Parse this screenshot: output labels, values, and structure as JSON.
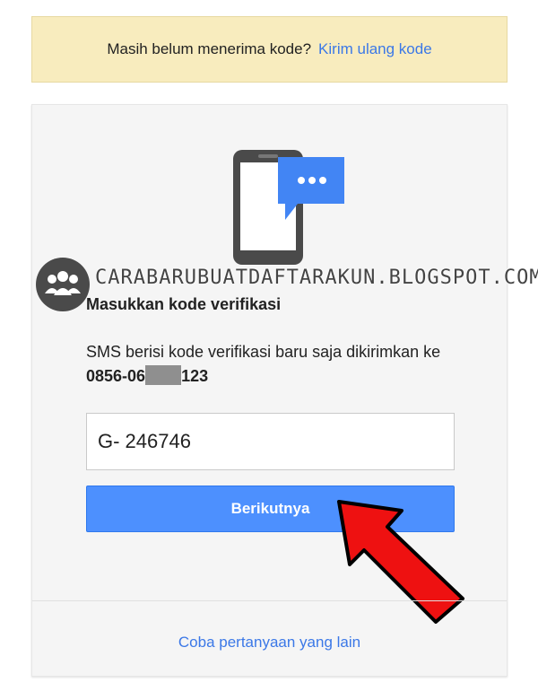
{
  "banner": {
    "message": "Masih belum menerima kode?",
    "resend_link": "Kirim ulang kode"
  },
  "watermark": {
    "text": "CARABARUBUATDAFTARAKUN.BLOGSPOT.COM"
  },
  "verification": {
    "title": "Masukkan kode verifikasi",
    "description": "SMS berisi kode verifikasi baru saja dikirimkan ke",
    "phone_prefix": "0856-06",
    "phone_suffix": "123",
    "code_value": "G- 246746",
    "next_button": "Berikutnya",
    "other_question_link": "Coba pertanyaan yang lain"
  },
  "colors": {
    "accent_blue": "#4d90fe",
    "link_blue": "#3b78e7",
    "banner_bg": "#f8ecbe",
    "arrow_red": "#ee1111"
  }
}
